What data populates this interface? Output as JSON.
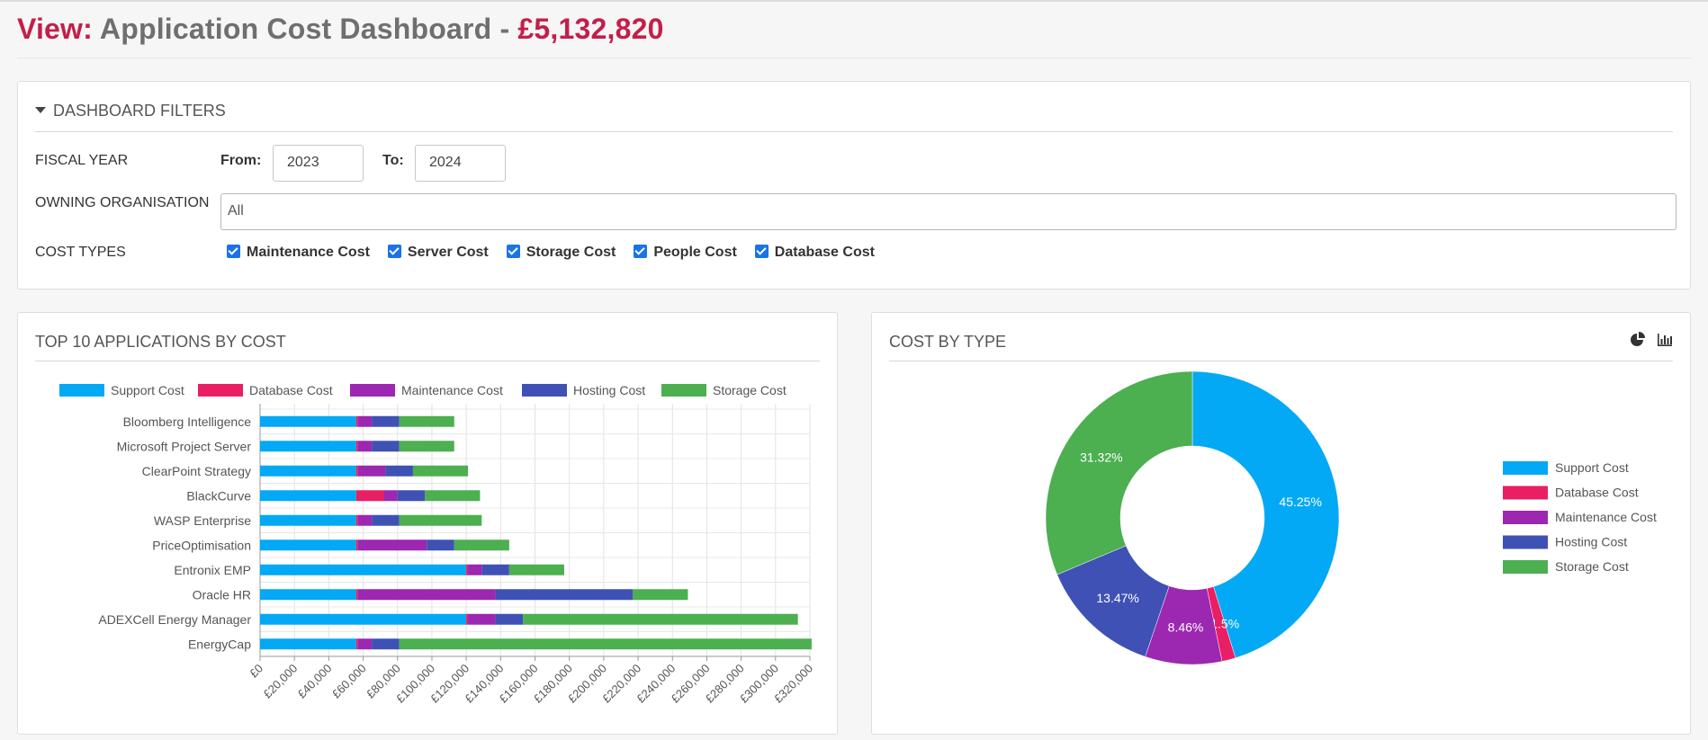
{
  "header": {
    "view_label": "View:",
    "title": "Application Cost Dashboard",
    "separator": "-",
    "total": "£5,132,820"
  },
  "filters": {
    "heading": "DASHBOARD FILTERS",
    "fiscal_year_label": "FISCAL YEAR",
    "from_label": "From:",
    "from_value": "2023",
    "to_label": "To:",
    "to_value": "2024",
    "org_label": "OWNING ORGANISATION",
    "org_value": "All",
    "cost_types_label": "COST TYPES",
    "cost_types": [
      {
        "label": "Maintenance Cost",
        "checked": true
      },
      {
        "label": "Server Cost",
        "checked": true
      },
      {
        "label": "Storage Cost",
        "checked": true
      },
      {
        "label": "People Cost",
        "checked": true
      },
      {
        "label": "Database Cost",
        "checked": true
      }
    ]
  },
  "top10": {
    "title": "TOP 10 APPLICATIONS BY COST"
  },
  "cost_by_type": {
    "title": "COST BY TYPE",
    "icons": [
      "pie-chart-icon",
      "bar-chart-icon"
    ]
  },
  "colors": {
    "support": "#03a9f4",
    "database": "#e91e63",
    "maintenance": "#9c27b0",
    "hosting": "#3f51b5",
    "storage": "#4caf50",
    "brand": "#c41e4a"
  },
  "chart_data": [
    {
      "type": "bar",
      "orientation": "horizontal",
      "stacked": true,
      "title": "TOP 10 APPLICATIONS BY COST",
      "legend_position": "top",
      "categories": [
        "Bloomberg Intelligence",
        "Microsoft Project Server",
        "ClearPoint Strategy",
        "BlackCurve",
        "WASP Enterprise",
        "PriceOptimisation",
        "Entronix EMP",
        "Oracle HR",
        "ADEXCell Energy Manager",
        "EnergyCap"
      ],
      "series": [
        {
          "name": "Support Cost",
          "color": "#03a9f4",
          "values": [
            56000,
            56000,
            56000,
            56000,
            56000,
            56000,
            120000,
            56000,
            120000,
            56000
          ]
        },
        {
          "name": "Database Cost",
          "color": "#e91e63",
          "values": [
            1000,
            1000,
            1000,
            16000,
            1000,
            1000,
            1000,
            1000,
            1000,
            1000
          ]
        },
        {
          "name": "Maintenance Cost",
          "color": "#9c27b0",
          "values": [
            8000,
            8000,
            16000,
            8000,
            8000,
            40000,
            8000,
            80000,
            16000,
            8000
          ]
        },
        {
          "name": "Hosting Cost",
          "color": "#3f51b5",
          "values": [
            16000,
            16000,
            16000,
            16000,
            16000,
            16000,
            16000,
            80000,
            16000,
            16000
          ]
        },
        {
          "name": "Storage Cost",
          "color": "#4caf50",
          "values": [
            32000,
            32000,
            32000,
            32000,
            48000,
            32000,
            32000,
            32000,
            160000,
            240000
          ]
        }
      ],
      "xlim": [
        0,
        320000
      ],
      "x_ticks": [
        "£0",
        "£20,000",
        "£40,000",
        "£60,000",
        "£80,000",
        "£100,000",
        "£120,000",
        "£140,000",
        "£160,000",
        "£180,000",
        "£200,000",
        "£220,000",
        "£240,000",
        "£260,000",
        "£280,000",
        "£300,000",
        "£320,000"
      ],
      "grid": true
    },
    {
      "type": "pie",
      "donut": true,
      "title": "COST BY TYPE",
      "legend_position": "right",
      "labels": [
        "Support Cost",
        "Database Cost",
        "Maintenance Cost",
        "Hosting Cost",
        "Storage Cost"
      ],
      "values": [
        45.25,
        1.5,
        8.46,
        13.47,
        31.32
      ],
      "value_labels": [
        "45.25%",
        "1.5%",
        "8.46%",
        "13.47%",
        "31.32%"
      ],
      "colors": [
        "#03a9f4",
        "#e91e63",
        "#9c27b0",
        "#3f51b5",
        "#4caf50"
      ]
    }
  ]
}
